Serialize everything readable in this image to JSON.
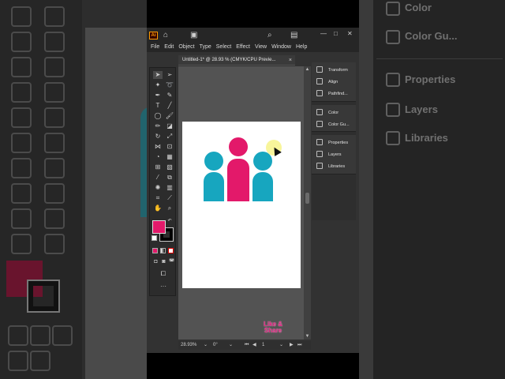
{
  "background": {
    "right_panels": [
      "Color",
      "Color Gu...",
      "Properties",
      "Layers",
      "Libraries"
    ]
  },
  "app": {
    "logo": "Ai",
    "menu": [
      "File",
      "Edit",
      "Object",
      "Type",
      "Select",
      "Effect",
      "View",
      "Window",
      "Help"
    ],
    "window_controls": {
      "minimize": "—",
      "maximize": "□",
      "close": "✕"
    },
    "tab": {
      "title": "Untitled-1* @ 28.93 % (CMYK/CPU Previe...",
      "close": "×"
    },
    "panels": {
      "group1": [
        "Transform",
        "Align",
        "Pathfind..."
      ],
      "group2": [
        "Color",
        "Color Gu..."
      ],
      "group3": [
        "Properties",
        "Layers",
        "Libraries"
      ]
    },
    "status": {
      "zoom": "28.93%",
      "rotation": "0°",
      "artboard": "1"
    },
    "colors": {
      "fill": "#e3196a",
      "teal": "#17a6bf",
      "pink": "#e3196a"
    },
    "watermark": {
      "line1": "Like &",
      "line2": "Share"
    }
  }
}
